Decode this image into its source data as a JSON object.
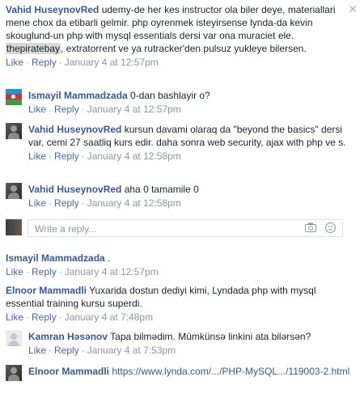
{
  "actions": {
    "like": "Like",
    "reply": "Reply"
  },
  "comments": [
    {
      "author": "Vahid HuseynovRed",
      "text_before": " udemy-de her kes instructor ola biler deye, materiallari mene chox da etibarli gelmir. php oyrenmek isteyirsense lynda-da kevin skouglund-un php with mysql essentials dersi var ona muraciet ele. ",
      "highlight": "thepiratebay",
      "text_after": ", extratorrent ve ya rutracker'den pulsuz yukleye bilersen.",
      "time": "January 4 at 12:57pm"
    },
    {
      "author": "Ismayil Mammadzada",
      "text": " 0-dan bashlayir o?",
      "time": "January 4 at 12:57pm"
    },
    {
      "author": "Vahid HuseynovRed",
      "text": " kursun davami olaraq da \"beyond the basics\" dersi var, cemi 27 saatliq kurs edir. daha sonra web security, ajax with php ve s.",
      "time": "January 4 at 12:58pm"
    },
    {
      "author": "Vahid HuseynovRed",
      "text": " aha 0 tamamile 0",
      "time": "January 4 at 12:58pm"
    },
    {
      "author": "Ismayil Mammadzada",
      "text": " .",
      "time": "January 4 at 12:57pm"
    },
    {
      "author": "Elnoor Mammadli",
      "text": " Yuxarida dostun dediyi kimi, Lyndada php with mysql essential training kursu superdi.",
      "time": "January 4 at 7:48pm"
    },
    {
      "author": "Kamran Həsənov",
      "text": " Tapa bilmədim. Mümkünsə linkini ata bilərsən?",
      "time": "January 4 at 7:53pm"
    },
    {
      "author": "Elnoor Mammadli",
      "link": " https://www.lynda.com/.../PHP-MySQL.../119003-2.html"
    }
  ],
  "reply_box": {
    "placeholder": "Write a reply...",
    "camera_icon": "camera-icon",
    "emoji_icon": "emoji-icon"
  },
  "close_icon": "close-icon"
}
